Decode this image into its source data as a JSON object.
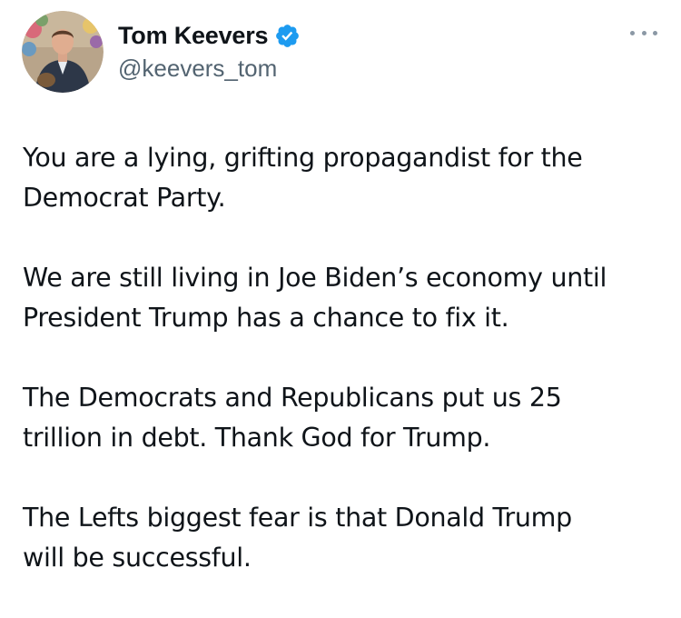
{
  "author": {
    "display_name": "Tom Keevers",
    "handle": "@keevers_tom",
    "verified": true,
    "verified_color": "#1d9bf0"
  },
  "icons": {
    "avatar": "profile-photo",
    "verified": "verified-badge-icon",
    "more": "more-options-icon"
  },
  "tweet": {
    "paragraphs": [
      "You are a lying, grifting propagandist for the\nDemocrat Party.",
      "We are still living in Joe Biden’s economy until\nPresident Trump has a chance to fix it.",
      "The Democrats and Republicans put us 25\ntrillion in debt. Thank God for Trump.",
      "The Lefts biggest fear is that Donald Trump\nwill be successful."
    ]
  }
}
